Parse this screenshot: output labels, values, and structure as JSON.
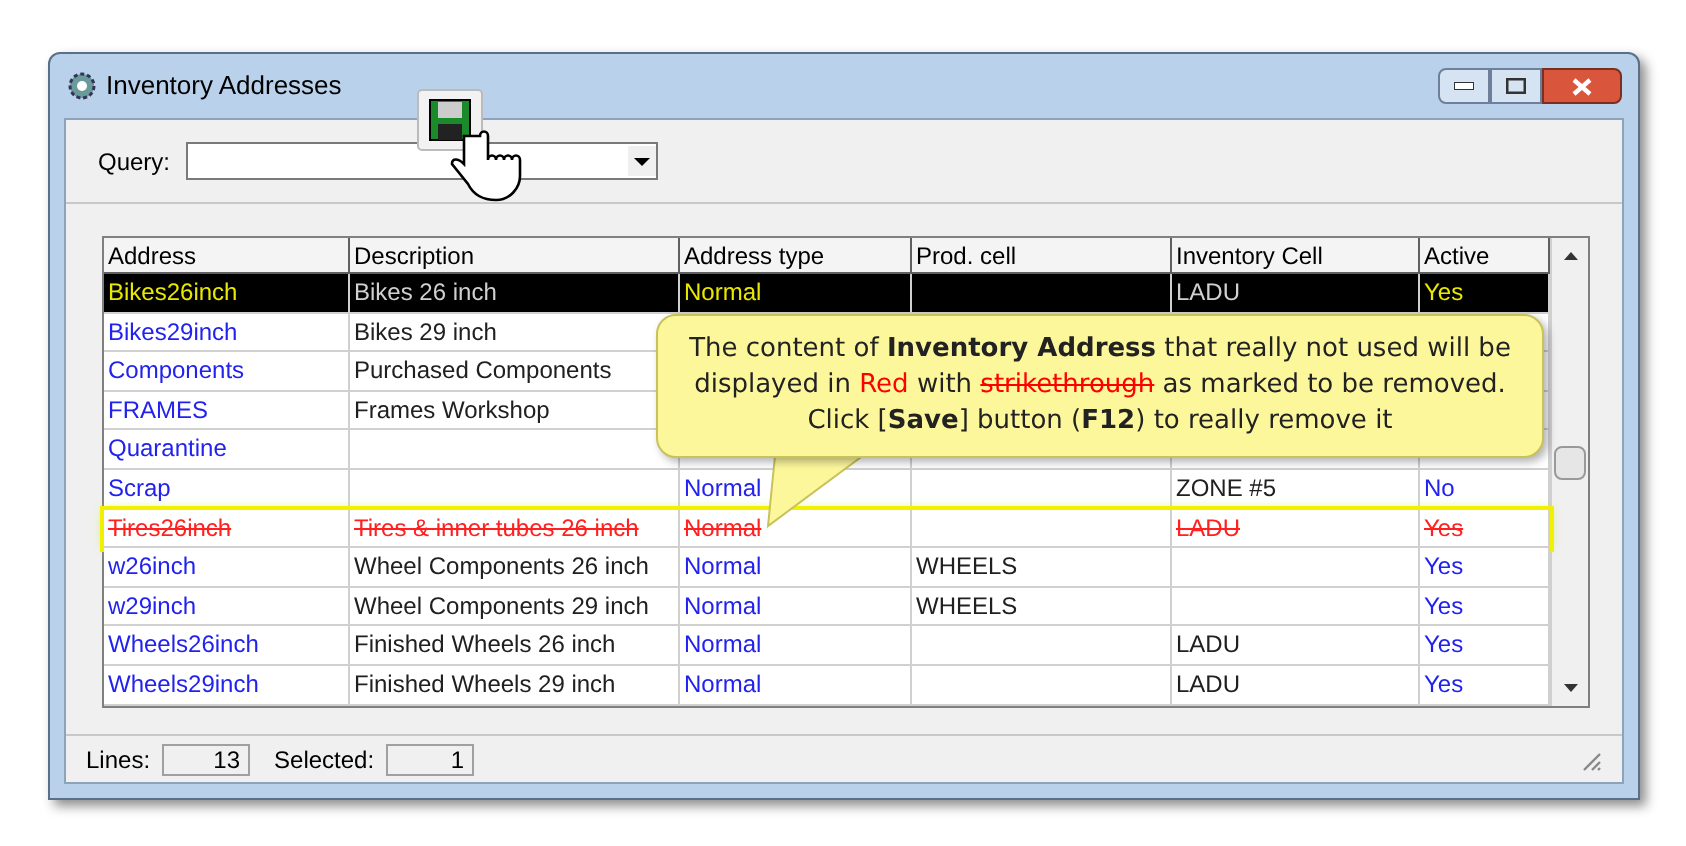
{
  "window": {
    "title": "Inventory Addresses"
  },
  "query": {
    "label": "Query:"
  },
  "table": {
    "columns": [
      "Address",
      "Description",
      "Address type",
      "Prod. cell",
      "Inventory Cell",
      "Active"
    ],
    "rows": [
      {
        "selected": true,
        "marked_for_removal": false,
        "cells": [
          "Bikes26inch",
          "Bikes 26 inch",
          "Normal",
          "",
          "LADU",
          "Yes"
        ]
      },
      {
        "selected": false,
        "marked_for_removal": false,
        "cells": [
          "Bikes29inch",
          "Bikes 29 inch",
          "",
          "",
          "",
          ""
        ]
      },
      {
        "selected": false,
        "marked_for_removal": false,
        "cells": [
          "Components",
          "Purchased Components",
          "",
          "",
          "",
          ""
        ]
      },
      {
        "selected": false,
        "marked_for_removal": false,
        "cells": [
          "FRAMES",
          "Frames Workshop",
          "",
          "",
          "",
          ""
        ]
      },
      {
        "selected": false,
        "marked_for_removal": false,
        "cells": [
          "Quarantine",
          "",
          "",
          "",
          "",
          ""
        ]
      },
      {
        "selected": false,
        "marked_for_removal": false,
        "cells": [
          "Scrap",
          "",
          "Normal",
          "",
          "ZONE #5",
          "No"
        ]
      },
      {
        "selected": false,
        "marked_for_removal": true,
        "cells": [
          "Tires26inch",
          "Tires & inner tubes 26 inch",
          "Normal",
          "",
          "LADU",
          "Yes"
        ]
      },
      {
        "selected": false,
        "marked_for_removal": false,
        "cells": [
          "w26inch",
          "Wheel Components 26 inch",
          "Normal",
          "WHEELS",
          "",
          "Yes"
        ]
      },
      {
        "selected": false,
        "marked_for_removal": false,
        "cells": [
          "w29inch",
          "Wheel Components 29 inch",
          "Normal",
          "WHEELS",
          "",
          "Yes"
        ]
      },
      {
        "selected": false,
        "marked_for_removal": false,
        "cells": [
          "Wheels26inch",
          "Finished Wheels 26 inch",
          "Normal",
          "",
          "LADU",
          "Yes"
        ]
      },
      {
        "selected": false,
        "marked_for_removal": false,
        "cells": [
          "Wheels29inch",
          "Finished Wheels 29 inch",
          "Normal",
          "",
          "LADU",
          "Yes"
        ]
      }
    ]
  },
  "status_bar": {
    "lines_label": "Lines:",
    "lines": "13",
    "selected_label": "Selected:",
    "selected": "1"
  },
  "callout": {
    "segments": [
      {
        "kind": "plain",
        "text": "The content of "
      },
      {
        "kind": "bold",
        "text": "Inventory Address"
      },
      {
        "kind": "plain",
        "text": " that really not used will be displayed in "
      },
      {
        "kind": "red",
        "text": "Red"
      },
      {
        "kind": "plain",
        "text": " with "
      },
      {
        "kind": "strike",
        "text": "strikethrough"
      },
      {
        "kind": "plain",
        "text": " as marked to be removed.  Click ["
      },
      {
        "kind": "bold",
        "text": "Save"
      },
      {
        "kind": "plain",
        "text": "] button ("
      },
      {
        "kind": "bold",
        "text": "F12"
      },
      {
        "kind": "plain",
        "text": ") to really remove it"
      }
    ]
  }
}
